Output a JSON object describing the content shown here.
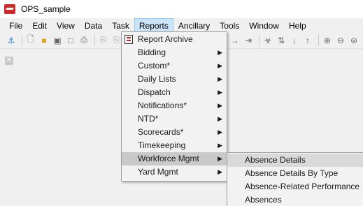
{
  "window": {
    "title": "OPS_sample"
  },
  "menubar": {
    "items": [
      "File",
      "Edit",
      "View",
      "Data",
      "Task",
      "Reports",
      "Ancillary",
      "Tools",
      "Window",
      "Help"
    ],
    "active": "Reports"
  },
  "toolbar": {
    "icons": [
      "pin-icon",
      "new-file-icon",
      "open-folder-icon",
      "save-icon",
      "print-preview-icon",
      "print-icon",
      "copy-icon",
      "paste-icon",
      "arrow-right-icon",
      "arrow-end-icon",
      "filter-icon",
      "sort-icon",
      "sort-asc-icon",
      "sort-desc-icon",
      "zoom-in-icon",
      "zoom-out-icon",
      "zoom-fit-icon"
    ]
  },
  "reports_menu": {
    "items": [
      {
        "label": "Report Archive",
        "has_submenu": false,
        "icon": "report-archive-icon"
      },
      {
        "label": "Bidding",
        "has_submenu": true
      },
      {
        "label": "Custom*",
        "has_submenu": true
      },
      {
        "label": "Daily Lists",
        "has_submenu": true
      },
      {
        "label": "Dispatch",
        "has_submenu": true
      },
      {
        "label": "Notifications*",
        "has_submenu": true
      },
      {
        "label": "NTD*",
        "has_submenu": true
      },
      {
        "label": "Scorecards*",
        "has_submenu": true
      },
      {
        "label": "Timekeeping",
        "has_submenu": true
      },
      {
        "label": "Workforce Mgmt",
        "has_submenu": true,
        "highlighted": true
      },
      {
        "label": "Yard Mgmt",
        "has_submenu": true
      }
    ]
  },
  "workforce_submenu": {
    "items": [
      {
        "label": "Absence Details",
        "highlighted": true
      },
      {
        "label": "Absence Details By Type"
      },
      {
        "label": "Absence-Related Performance"
      },
      {
        "label": "Absences"
      }
    ]
  },
  "colors": {
    "active_menu_bg": "#cce4f7",
    "highlight_bg": "#c9c9c9",
    "app_icon": "#cf2a2a"
  }
}
